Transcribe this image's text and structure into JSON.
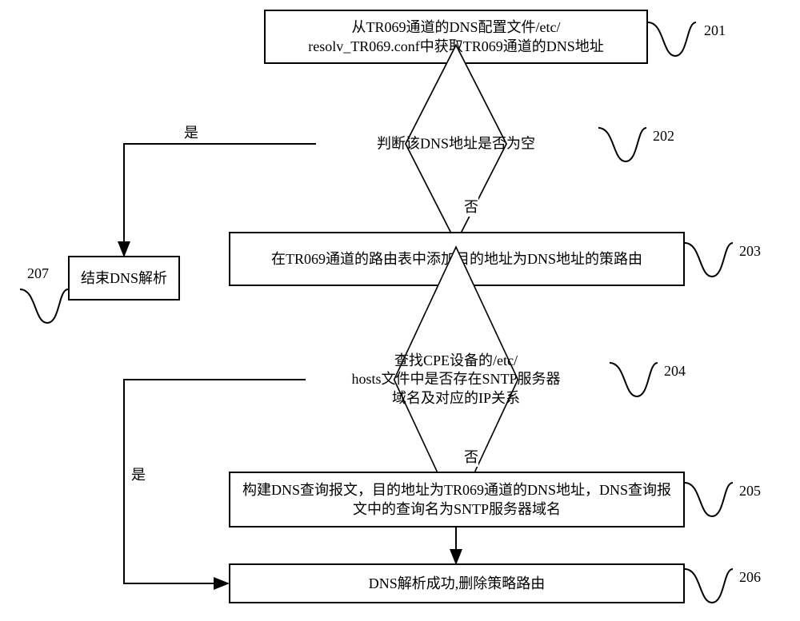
{
  "nodes": {
    "n201": "从TR069通道的DNS配置文件/etc/\nresolv_TR069.conf中获取TR069通道的DNS地址",
    "n202": "判断该DNS地址是否为空",
    "n203": "在TR069通道的路由表中添加目的地址为DNS地址的策路由",
    "n204": "查找CPE设备的/etc/\nhosts文件中是否存在SNTP服务器\n域名及对应的IP关系",
    "n205": "构建DNS查询报文，目的地址为TR069通道的DNS地址，DNS查询报\n文中的查询名为SNTP服务器域名",
    "n206": "DNS解析成功,删除策略路由",
    "n207": "结束DNS解析"
  },
  "step_labels": {
    "s201": "201",
    "s202": "202",
    "s203": "203",
    "s204": "204",
    "s205": "205",
    "s206": "206",
    "s207": "207"
  },
  "edge_labels": {
    "yes1": "是",
    "no1": "否",
    "yes2": "是",
    "no2": "否"
  },
  "chart_data": {
    "type": "flowchart",
    "nodes": [
      {
        "id": "201",
        "shape": "process",
        "text": "从TR069通道的DNS配置文件/etc/resolv_TR069.conf中获取TR069通道的DNS地址"
      },
      {
        "id": "202",
        "shape": "decision",
        "text": "判断该DNS地址是否为空"
      },
      {
        "id": "203",
        "shape": "process",
        "text": "在TR069通道的路由表中添加目的地址为DNS地址的策路由"
      },
      {
        "id": "204",
        "shape": "decision",
        "text": "查找CPE设备的/etc/hosts文件中是否存在SNTP服务器域名及对应的IP关系"
      },
      {
        "id": "205",
        "shape": "process",
        "text": "构建DNS查询报文，目的地址为TR069通道的DNS地址，DNS查询报文中的查询名为SNTP服务器域名"
      },
      {
        "id": "206",
        "shape": "process",
        "text": "DNS解析成功,删除策略路由"
      },
      {
        "id": "207",
        "shape": "process",
        "text": "结束DNS解析"
      }
    ],
    "edges": [
      {
        "from": "201",
        "to": "202",
        "label": ""
      },
      {
        "from": "202",
        "to": "207",
        "label": "是"
      },
      {
        "from": "202",
        "to": "203",
        "label": "否"
      },
      {
        "from": "203",
        "to": "204",
        "label": ""
      },
      {
        "from": "204",
        "to": "206",
        "label": "是"
      },
      {
        "from": "204",
        "to": "205",
        "label": "否"
      },
      {
        "from": "205",
        "to": "206",
        "label": ""
      }
    ]
  }
}
